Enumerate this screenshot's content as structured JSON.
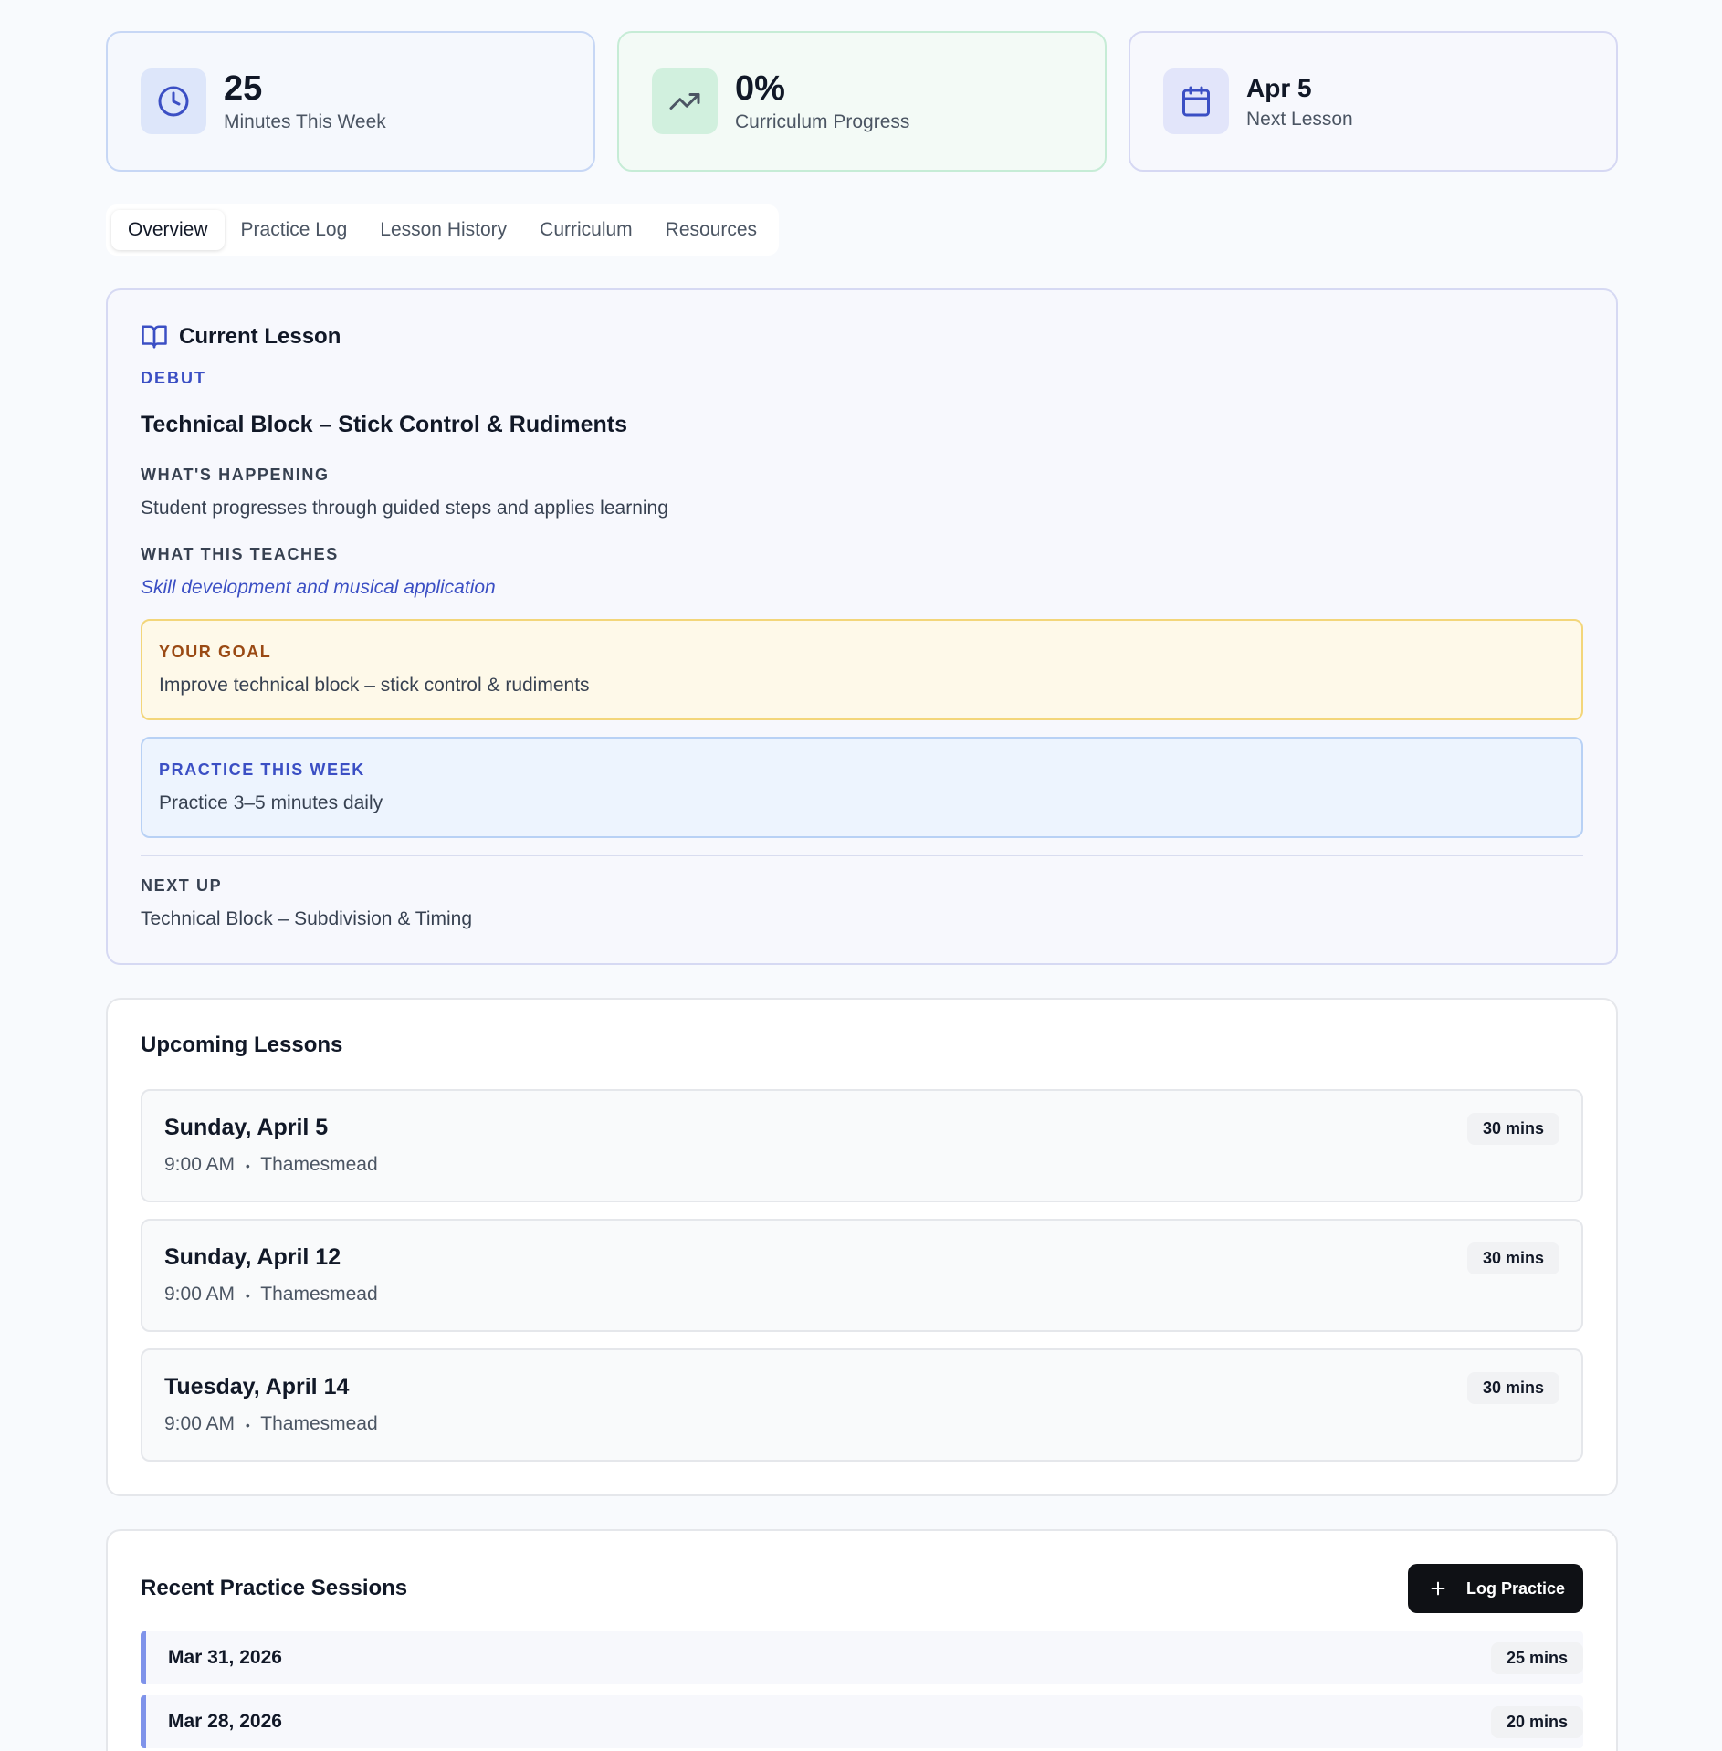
{
  "stats": [
    {
      "value": "25",
      "label": "Minutes This Week",
      "icon": "clock-icon"
    },
    {
      "value": "0%",
      "label": "Curriculum Progress",
      "icon": "trending-up-icon"
    },
    {
      "value": "Apr 5",
      "label": "Next Lesson",
      "icon": "calendar-icon"
    }
  ],
  "tabs": [
    "Overview",
    "Practice Log",
    "Lesson History",
    "Curriculum",
    "Resources"
  ],
  "current_lesson": {
    "heading": "Current Lesson",
    "level": "DEBUT",
    "title": "Technical Block – Stick Control & Rudiments",
    "happening_label": "WHAT'S HAPPENING",
    "happening_text": "Student progresses through guided steps and applies learning",
    "teaches_label": "WHAT THIS TEACHES",
    "teaches_text": "Skill development and musical application",
    "goal_label": "YOUR GOAL",
    "goal_text": "Improve technical block – stick control & rudiments",
    "practice_label": "PRACTICE THIS WEEK",
    "practice_text": "Practice 3–5 minutes daily",
    "next_label": "NEXT UP",
    "next_text": "Technical Block – Subdivision & Timing"
  },
  "upcoming": {
    "heading": "Upcoming Lessons",
    "lessons": [
      {
        "date": "Sunday, April 5",
        "time": "9:00 AM",
        "location": "Thamesmead",
        "duration": "30 mins"
      },
      {
        "date": "Sunday, April 12",
        "time": "9:00 AM",
        "location": "Thamesmead",
        "duration": "30 mins"
      },
      {
        "date": "Tuesday, April 14",
        "time": "9:00 AM",
        "location": "Thamesmead",
        "duration": "30 mins"
      }
    ]
  },
  "recent": {
    "heading": "Recent Practice Sessions",
    "button_label": "Log Practice",
    "sessions": [
      {
        "date": "Mar 31, 2026",
        "duration": "25 mins"
      },
      {
        "date": "Mar 28, 2026",
        "duration": "20 mins"
      }
    ]
  },
  "meta_separator": "•",
  "colors": {
    "accent": "#3b4fc4",
    "primary_button": "#0f1115",
    "goal_border": "#f3d67a"
  }
}
